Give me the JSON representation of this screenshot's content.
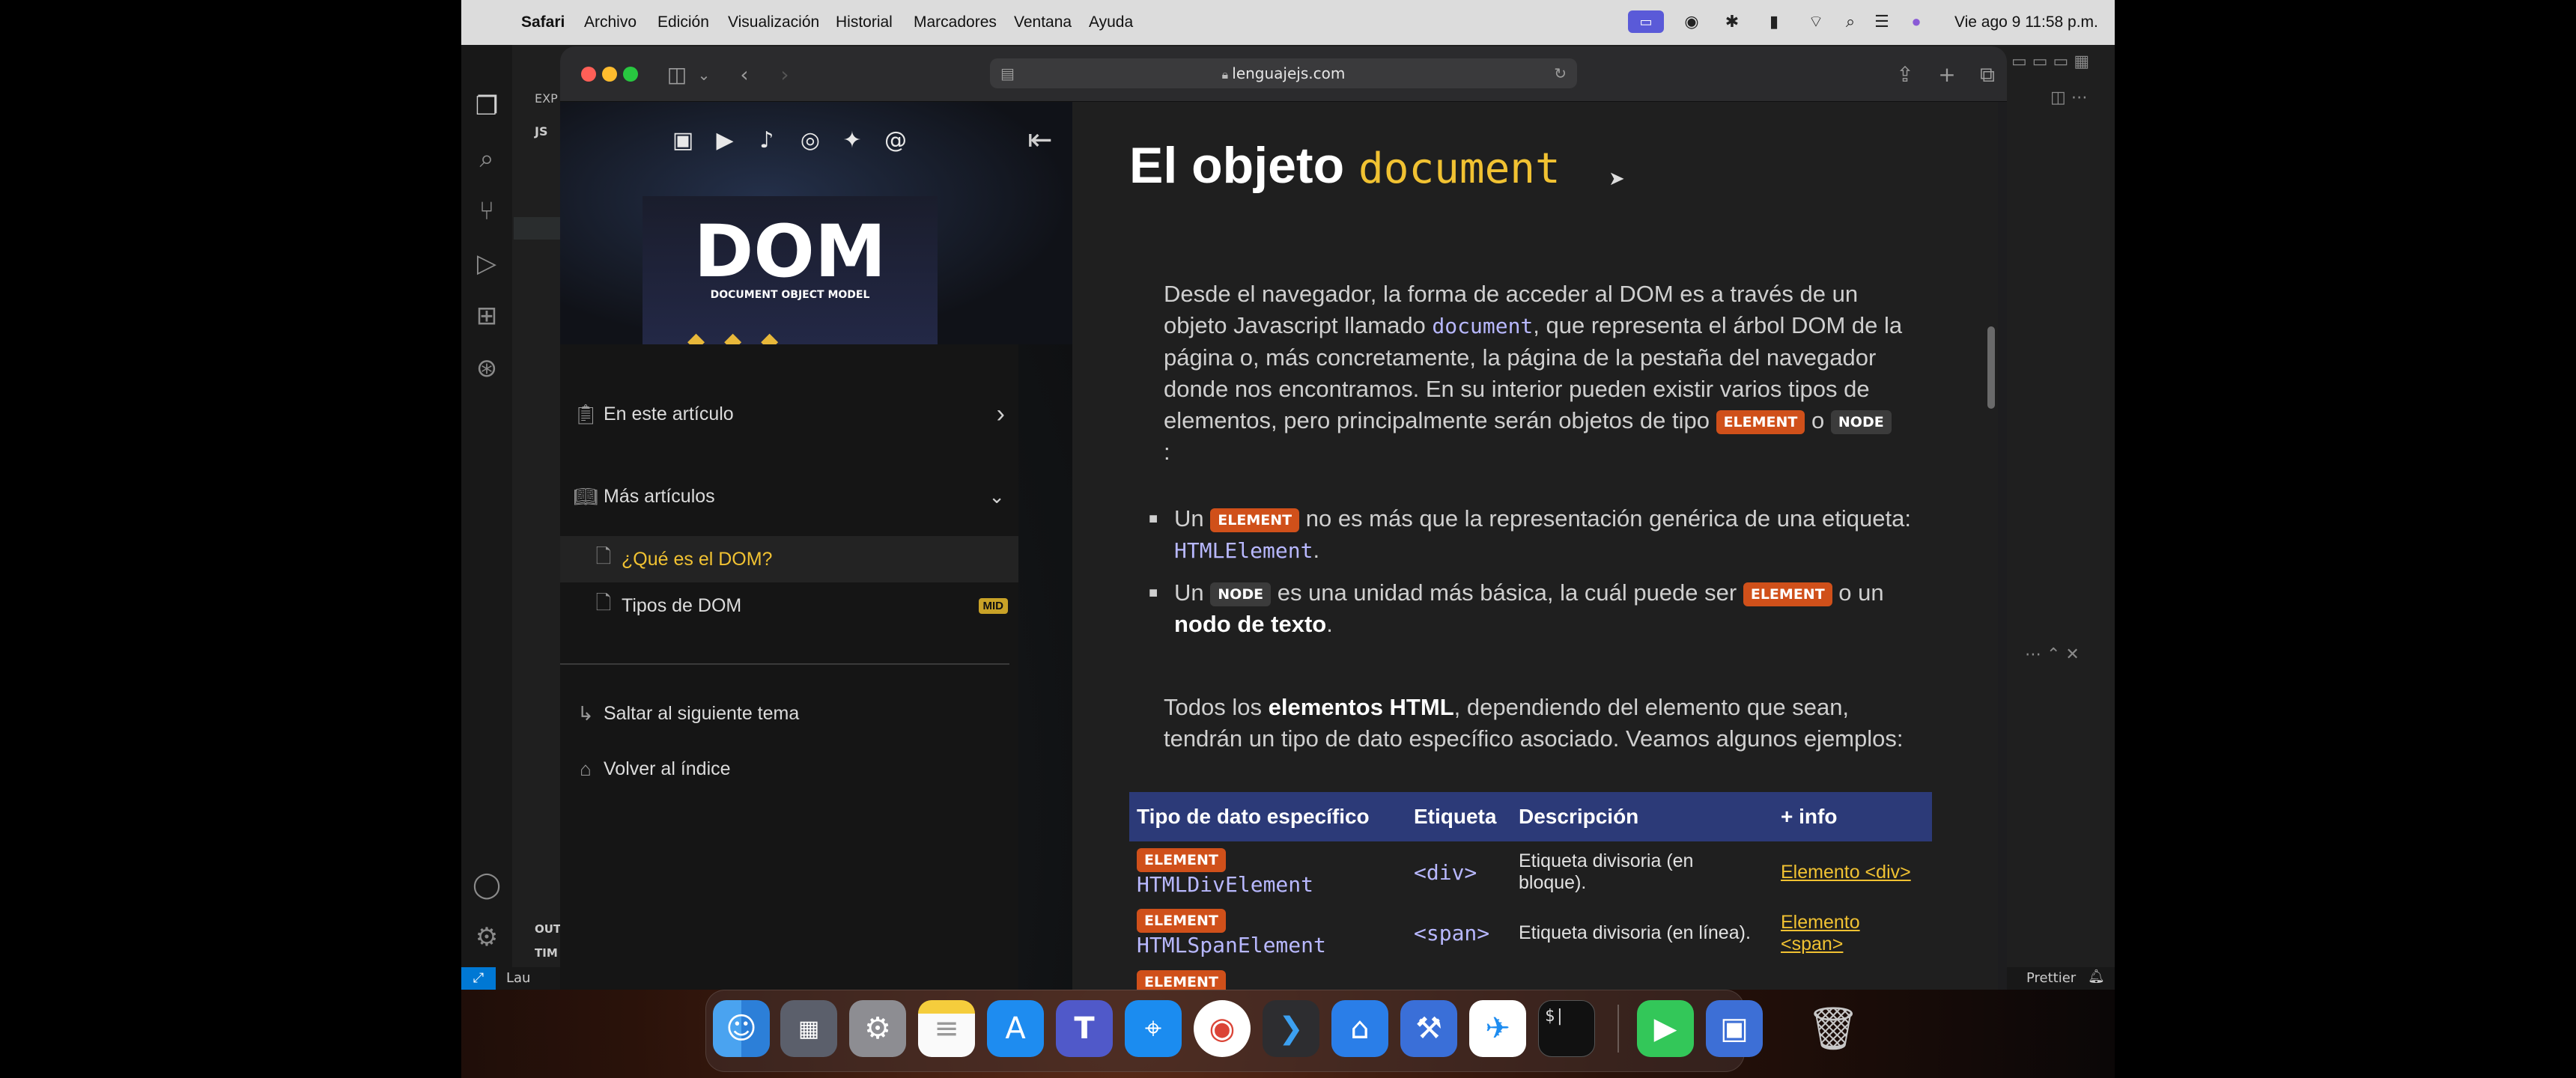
{
  "menubar": {
    "apple": "",
    "app": "Safari",
    "items": [
      "Archivo",
      "Edición",
      "Visualización",
      "Historial",
      "Marcadores",
      "Ventana",
      "Ayuda"
    ],
    "clock": "Vie ago 9  11:58 p.m."
  },
  "vscode": {
    "explorer_label": "EXP",
    "js_label": "JS",
    "outline_label": "OUT",
    "timeline_label": "TIM",
    "status_left": "Lau",
    "status_right": "Prettier"
  },
  "safari": {
    "url": "lenguajejs.com"
  },
  "sidebar": {
    "cover_title": "DOM",
    "cover_subtitle": "DOCUMENT OBJECT MODEL",
    "in_article": "En este artículo",
    "more_articles": "Más artículos",
    "articles": [
      {
        "label": "¿Qué es el DOM?",
        "badge": ""
      },
      {
        "label": "Tipos de DOM",
        "badge": "MID"
      }
    ],
    "next_topic": "Saltar al siguiente tema",
    "back_index": "Volver al índice"
  },
  "article": {
    "title_plain": "El objeto",
    "title_code": "document",
    "p1_a": "Desde el navegador, la forma de acceder al DOM es a través de un",
    "p1_b": "objeto Javascript llamado",
    "p1_code": "document",
    "p1_c": ", que representa el árbol DOM de la",
    "p1_d": "página o, más concretamente, la página de la pestaña del navegador",
    "p1_e": "donde nos encontramos. En su interior pueden existir varios tipos de",
    "p1_f": "elementos, pero principalmente serán objetos de tipo",
    "badge_element": "ELEMENT",
    "badge_node": "NODE",
    "p1_or": "o",
    "p1_colon": ":",
    "li1_a": "Un",
    "li1_b": "no es más que la representación genérica de una etiqueta:",
    "li1_code": "HTMLElement",
    "li1_end": ".",
    "li2_a": "Un",
    "li2_b": "es una unidad más básica, la cuál puede ser",
    "li2_c": "o un",
    "li2_bold": "nodo de texto",
    "li2_end": ".",
    "p2_a": "Todos los",
    "p2_bold": "elementos HTML",
    "p2_b": ", dependiendo del elemento que sean,",
    "p2_c": "tendrán un tipo de dato específico asociado. Veamos algunos ejemplos:"
  },
  "table": {
    "headers": [
      "Tipo de dato específico",
      "Etiqueta",
      "Descripción",
      "+ info"
    ],
    "rows": [
      {
        "badge": "ELEMENT",
        "type": "HTMLDivElement",
        "tag": "<div>",
        "desc": "Etiqueta divisoria (en bloque).",
        "info": "Elemento <div>"
      },
      {
        "badge": "ELEMENT",
        "type": "HTMLSpanElement",
        "tag": "<span>",
        "desc": "Etiqueta divisoria (en línea).",
        "info": "Elemento <span>"
      },
      {
        "badge": "ELEMENT",
        "type": "",
        "tag": "",
        "desc": "",
        "info": ""
      }
    ]
  },
  "dock": {
    "apps": [
      "finder-icon",
      "launchpad-icon",
      "system-settings-icon",
      "notes-icon",
      "app-store-icon",
      "teams-icon",
      "safari-icon",
      "chrome-icon",
      "vscode-icon",
      "acrobat-icon",
      "xcode-icon",
      "testflight-icon",
      "terminal-icon",
      "facetime-icon",
      "preview-icon",
      "trash-icon"
    ],
    "terminal_text": "$|"
  },
  "colors": {
    "accent_yellow": "#f1c232",
    "element_badge": "#d0501a",
    "table_header": "#2c3a78"
  }
}
